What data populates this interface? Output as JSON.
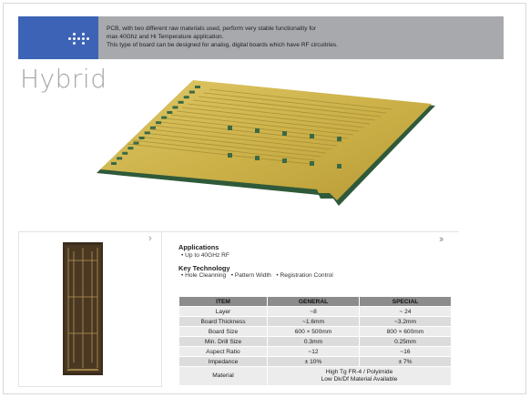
{
  "banner": {
    "line1": "PCB, with two different raw materials used, perform very stable functionality for",
    "line2": "max 40Ghz and Hi Temperature application.",
    "line3": "This type of board can be designed for analog, digital boards which have RF circuitries."
  },
  "title": "Hybrid",
  "applications": {
    "heading": "Applications",
    "items": [
      "Up to 40GHz RF"
    ]
  },
  "key_technology": {
    "heading": "Key Technology",
    "items": [
      "Hole Cleanning",
      "Pattern Width",
      "Registration Control"
    ]
  },
  "spec_table": {
    "headers": [
      "ITEM",
      "GENERAL",
      "SPECIAL"
    ],
    "rows": [
      {
        "item": "Layer",
        "general": "~8",
        "special": "~ 24"
      },
      {
        "item": "Board Thickness",
        "general": "~1.6mm",
        "special": "~3.2mm"
      },
      {
        "item": "Board Size",
        "general": "600 × 500mm",
        "special": "800 × 600mm"
      },
      {
        "item": "Min. Drill Size",
        "general": "0.3mm",
        "special": "0.25mm"
      },
      {
        "item": "Aspect Ratio",
        "general": "~12",
        "special": "~16"
      },
      {
        "item": "Impedance",
        "general": "± 10%",
        "special": "± 7%"
      }
    ],
    "material": {
      "item": "Material",
      "line1": "High Tg FR-4 / Polyimide",
      "line2": "Low Dk/Df Material Available"
    }
  },
  "colors": {
    "banner_blue": "#3c63b6",
    "banner_gray": "#a7a9ac",
    "pcb_gold": "#cdb24a",
    "pcb_green": "#2f5a3a"
  },
  "icons": {
    "arrow_small": "chevron-right-icon",
    "arrow_double": "double-chevron-right-icon"
  }
}
